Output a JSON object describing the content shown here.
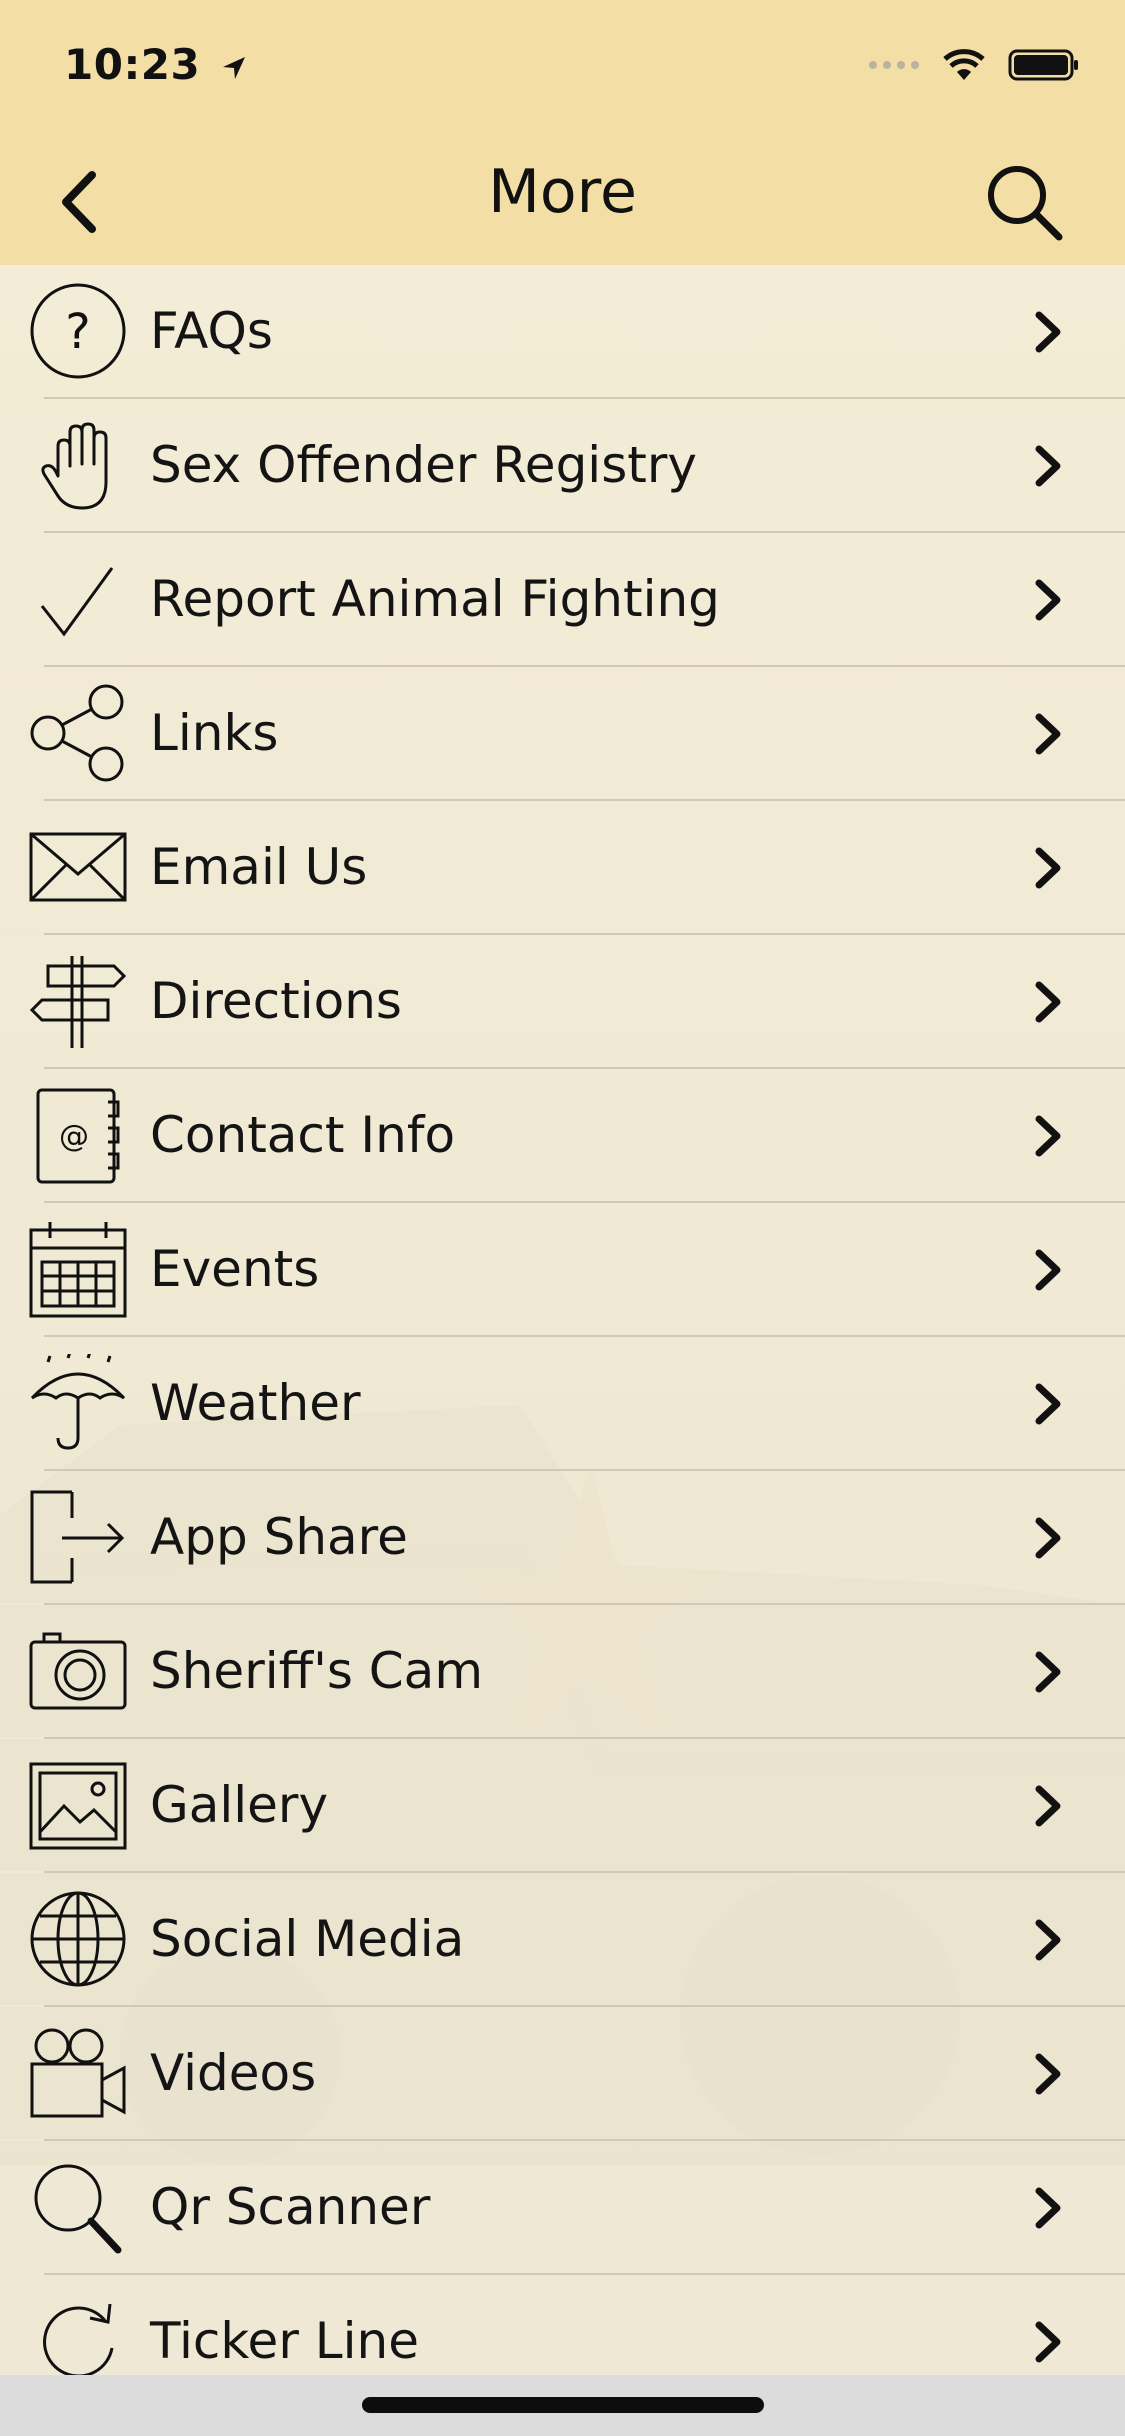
{
  "status": {
    "time": "10:23"
  },
  "nav": {
    "title": "More"
  },
  "menu": {
    "items": [
      {
        "label": "FAQs",
        "icon": "question-icon"
      },
      {
        "label": "Sex Offender Registry",
        "icon": "hand-icon"
      },
      {
        "label": "Report Animal Fighting",
        "icon": "checkmark-icon"
      },
      {
        "label": "Links",
        "icon": "share-nodes-icon"
      },
      {
        "label": "Email Us",
        "icon": "envelope-icon"
      },
      {
        "label": "Directions",
        "icon": "signpost-icon"
      },
      {
        "label": "Contact Info",
        "icon": "address-book-icon"
      },
      {
        "label": "Events",
        "icon": "calendar-icon"
      },
      {
        "label": "Weather",
        "icon": "umbrella-icon"
      },
      {
        "label": "App Share",
        "icon": "export-icon"
      },
      {
        "label": "Sheriff's Cam",
        "icon": "camera-icon"
      },
      {
        "label": "Gallery",
        "icon": "image-icon"
      },
      {
        "label": "Social Media",
        "icon": "globe-icon"
      },
      {
        "label": "Videos",
        "icon": "video-camera-icon"
      },
      {
        "label": "Qr Scanner",
        "icon": "magnifier-icon"
      },
      {
        "label": "Ticker Line",
        "icon": "refresh-icon"
      }
    ]
  },
  "colors": {
    "header_bg": "#f3dea5",
    "row_bg": "#f3ecd6",
    "divider": "#cfc9b8",
    "text": "#141414"
  }
}
